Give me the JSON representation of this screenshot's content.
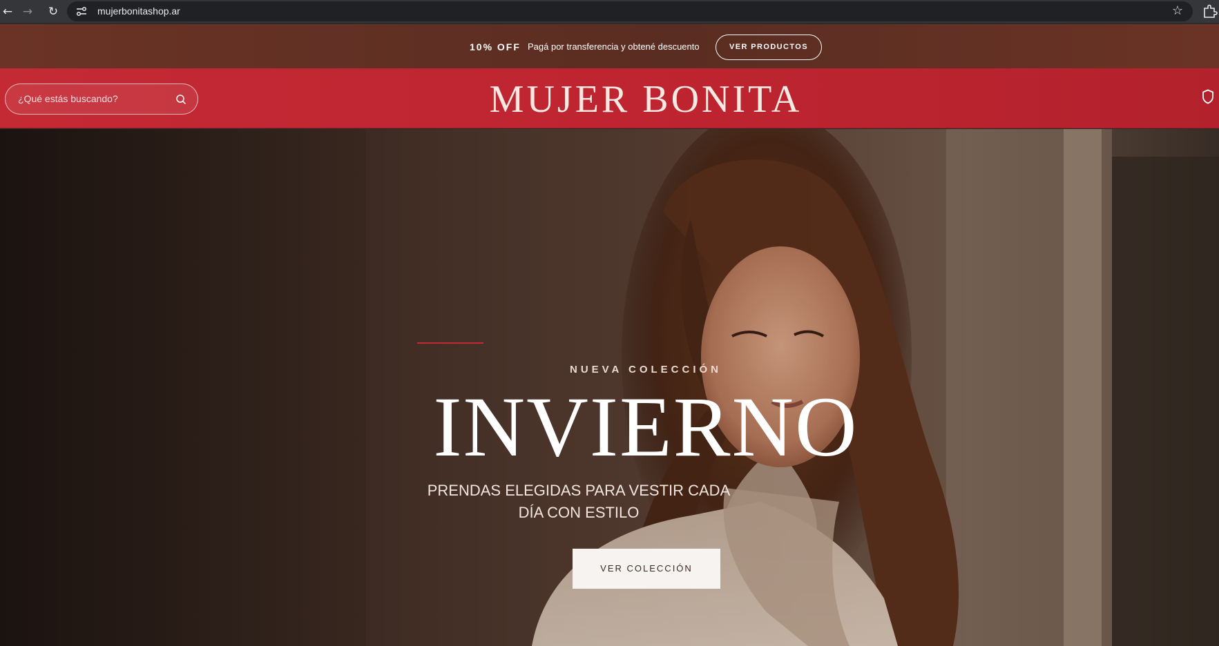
{
  "browser": {
    "url": "mujerbonitashop.ar",
    "icons": [
      "back-icon",
      "forward-icon",
      "reload-icon",
      "site-settings-icon",
      "bookmark-star-icon",
      "extensions-icon"
    ]
  },
  "promo": {
    "discount": "10% OFF",
    "message": "Pagá por transferencia y obtené descuento",
    "button_label": "VER PRODUCTOS"
  },
  "header": {
    "search_placeholder": "¿Qué estás buscando?",
    "logo": "MUJER BONITA",
    "icons": [
      "search-icon",
      "user-icon"
    ]
  },
  "hero": {
    "eyebrow": "NUEVA COLECCIÓN",
    "headline": "INVIERNO",
    "subtitle": "PRENDAS ELEGIDAS PARA VESTIR CADA DÍA CON ESTILO",
    "cta_label": "VER COLECCIÓN"
  },
  "colors": {
    "promo_bar": "#5a2d22",
    "header_red": "#c42a34",
    "accent_line": "#c42a34",
    "cta_bg": "#f6f3f1"
  }
}
